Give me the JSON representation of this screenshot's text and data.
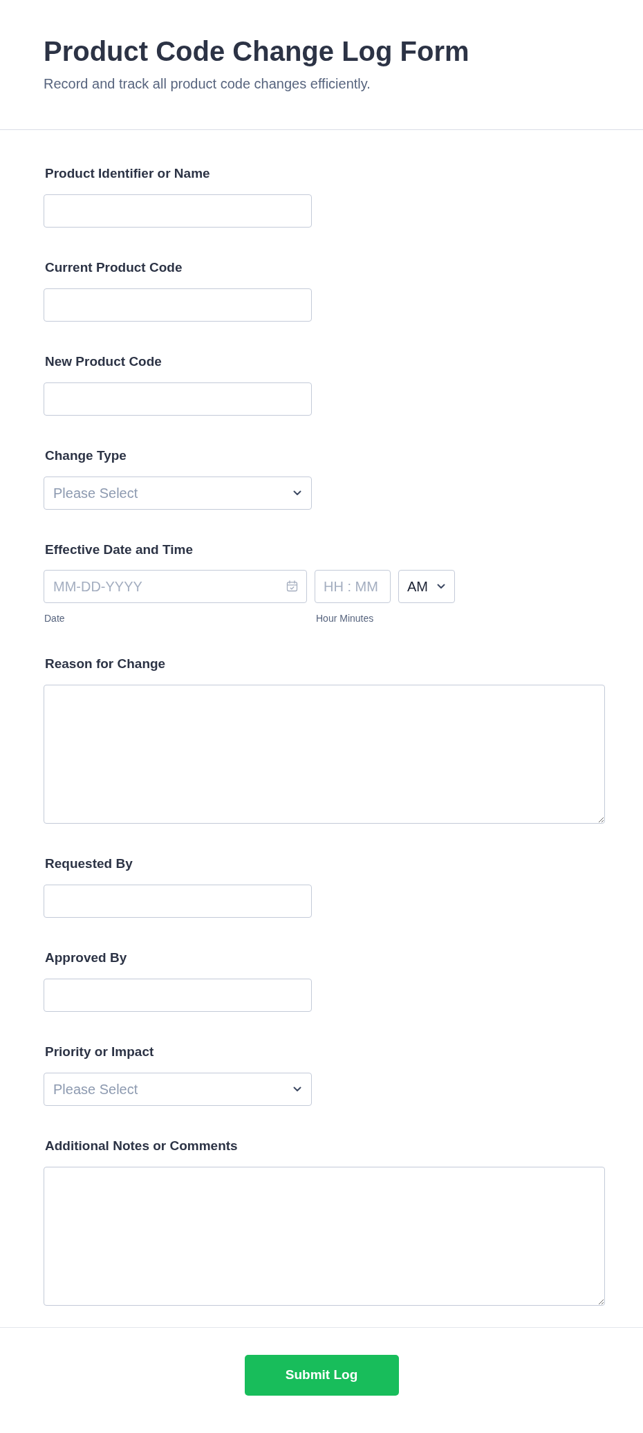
{
  "header": {
    "title": "Product Code Change Log Form",
    "subtitle": "Record and track all product code changes efficiently."
  },
  "fields": [
    {
      "kind": "text",
      "label": "Product Identifier or Name"
    },
    {
      "kind": "text",
      "label": "Current Product Code"
    },
    {
      "kind": "text",
      "label": "New Product Code"
    },
    {
      "kind": "select",
      "label": "Change Type",
      "placeholder": "Please Select"
    },
    {
      "kind": "datetime",
      "label": "Effective Date and Time",
      "date": {
        "placeholder": "MM-DD-YYYY",
        "sublabel": "Date"
      },
      "time": {
        "placeholder": "HH : MM",
        "sublabel": "Hour Minutes"
      },
      "period": {
        "value": "AM"
      }
    },
    {
      "kind": "textarea",
      "label": "Reason for Change"
    },
    {
      "kind": "text",
      "label": "Requested By"
    },
    {
      "kind": "text",
      "label": "Approved By"
    },
    {
      "kind": "select",
      "label": "Priority or Impact",
      "placeholder": "Please Select"
    },
    {
      "kind": "textarea",
      "label": "Additional Notes or Comments"
    }
  ],
  "submit": {
    "label": "Submit Log"
  }
}
